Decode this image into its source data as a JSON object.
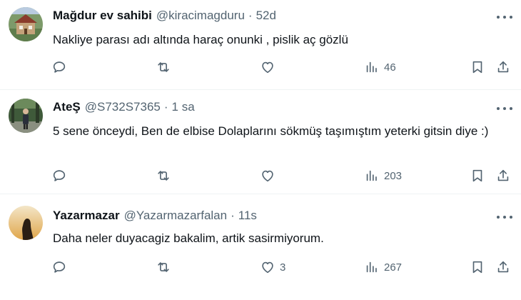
{
  "colors": {
    "text": "#0f1419",
    "muted": "#536471",
    "divider": "#eff3f4"
  },
  "tweets": [
    {
      "name": "Mağdur ev sahibi",
      "handle": "@kiracimagduru",
      "separator": "·",
      "time": "52d",
      "text": "Nakliye parası adı altında haraç onunki , pislik aç gözlü",
      "likes": "",
      "views": "46",
      "avatar": "house-photo"
    },
    {
      "name": "AteŞ",
      "handle": "@S732S7365",
      "separator": "·",
      "time": "1 sa",
      "text": "5 sene önceydi, Ben de elbise Dolaplarını sökmüş taşımıştım yeterki gitsin diye :)",
      "likes": "",
      "views": "203",
      "avatar": "person-in-park-photo"
    },
    {
      "name": "Yazarmazar",
      "handle": "@Yazarmazarfalan",
      "separator": "·",
      "time": "11s",
      "text": "Daha neler duyacagiz bakalim, artik sasirmiyorum.",
      "likes": "3",
      "views": "267",
      "avatar": "silhouette-sunset-photo"
    }
  ]
}
